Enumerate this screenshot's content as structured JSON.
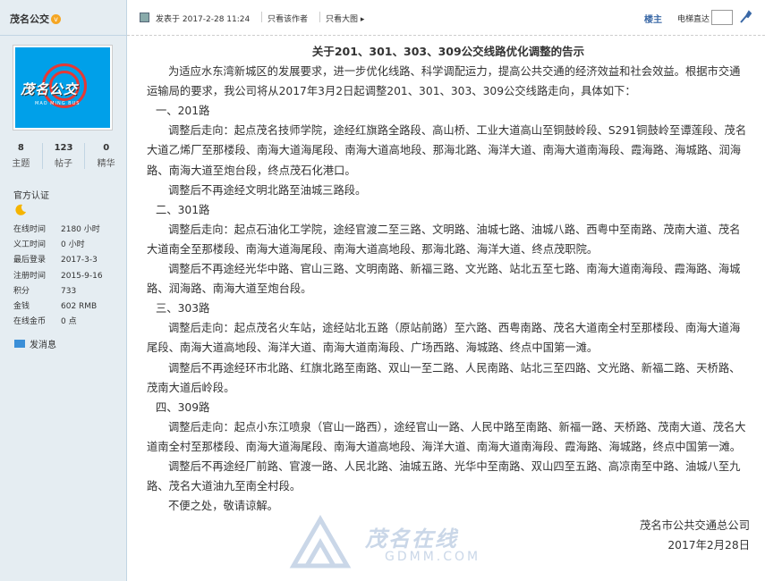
{
  "sidebar": {
    "username": "茂名公交",
    "verify_badge": "v",
    "avatar_text": "茂名公交",
    "avatar_sub": "MAO MING BUS",
    "stats": [
      {
        "num": "8",
        "label": "主题"
      },
      {
        "num": "123",
        "label": "帖子"
      },
      {
        "num": "0",
        "label": "精华"
      }
    ],
    "cert_label": "官方认证",
    "info": [
      {
        "k": "在线时间",
        "v": "2180 小时"
      },
      {
        "k": "义工时间",
        "v": "0 小时"
      },
      {
        "k": "最后登录",
        "v": "2017-3-3"
      },
      {
        "k": "注册时间",
        "v": "2015-9-16"
      },
      {
        "k": "积分",
        "v": "733"
      },
      {
        "k": "金钱",
        "v": "602 RMB"
      },
      {
        "k": "在线金币",
        "v": "0 点"
      }
    ],
    "message_label": "发消息"
  },
  "toolbar": {
    "posted": "发表于 2017-2-28 11:24",
    "author_only": "只看该作者",
    "big_image": "只看大图 ▸",
    "floor": "楼主",
    "direct": "电梯直达"
  },
  "article": {
    "title": "关于201、301、303、309公交线路优化调整的告示",
    "intro": "为适应水东湾新城区的发展要求，进一步优化线路、科学调配运力，提高公共交通的经济效益和社会效益。根据市交通运输局的要求，我公司将从2017年3月2日起调整201、301、303、309公交线路走向，具体如下：",
    "s201_h": "一、201路",
    "s201_a": "调整后走向：起点茂名技师学院，途经红旗路全路段、高山桥、工业大道高山至铜鼓岭段、S291铜鼓岭至谭莲段、茂名大道乙烯厂至那楼段、南海大道海尾段、南海大道高地段、那海北路、海洋大道、南海大道南海段、霞海路、海城路、润海路、南海大道至炮台段，终点茂石化港口。",
    "s201_b": "调整后不再途经文明北路至油城三路段。",
    "s301_h": "二、301路",
    "s301_a": "调整后走向：起点石油化工学院，途经官渡二至三路、文明路、油城七路、油城八路、西粤中至南路、茂南大道、茂名大道南全至那楼段、南海大道海尾段、南海大道高地段、那海北路、海洋大道、终点茂职院。",
    "s301_b": "调整后不再途经光华中路、官山三路、文明南路、新福三路、文光路、站北五至七路、南海大道南海段、霞海路、海城路、润海路、南海大道至炮台段。",
    "s303_h": "三、303路",
    "s303_a": "调整后走向：起点茂名火车站，途经站北五路（原站前路）至六路、西粤南路、茂名大道南全村至那楼段、南海大道海尾段、南海大道高地段、海洋大道、南海大道南海段、广场西路、海城路、终点中国第一滩。",
    "s303_b": "调整后不再途经环市北路、红旗北路至南路、双山一至二路、人民南路、站北三至四路、文光路、新福二路、天桥路、茂南大道后岭段。",
    "s309_h": "四、309路",
    "s309_a": "调整后走向：起点小东江喷泉（官山一路西），途经官山一路、人民中路至南路、新福一路、天桥路、茂南大道、茂名大道南全村至那楼段、南海大道海尾段、南海大道高地段、海洋大道、南海大道南海段、霞海路、海城路，终点中国第一滩。",
    "s309_b": "调整后不再途经厂前路、官渡一路、人民北路、油城五路、光华中至南路、双山四至五路、高凉南至中路、油城八至九路、茂名大道油九至南全村段。",
    "closing": "不便之处，敬请谅解。",
    "signer": "茂名市公共交通总公司",
    "date": "2017年2月28日"
  },
  "watermark": {
    "cn": "茂名在线",
    "en": "GDMM.COM"
  }
}
